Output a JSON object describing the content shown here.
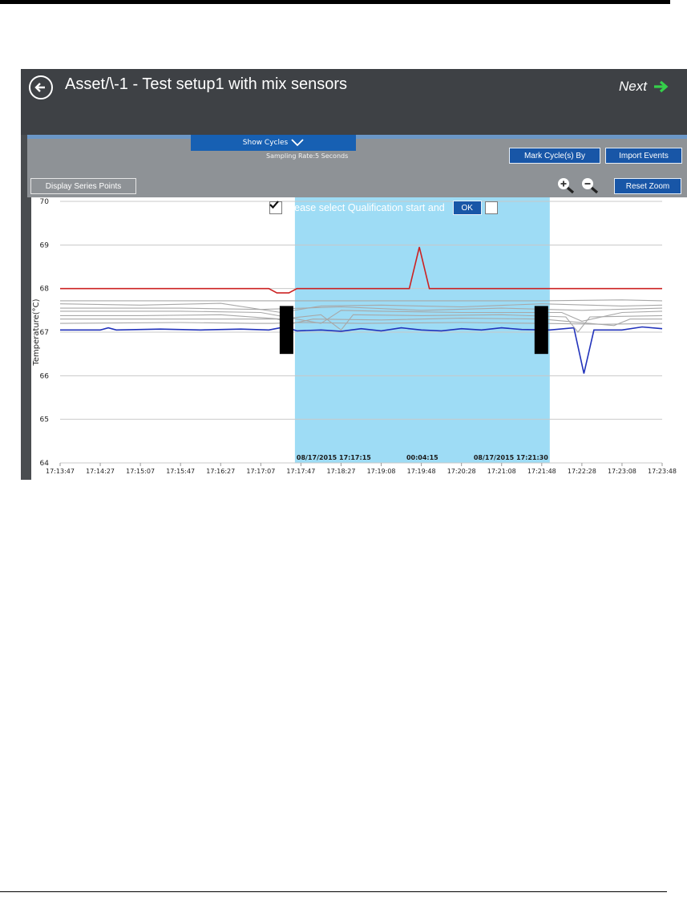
{
  "window": {
    "title": "Asset/\\-1 - Test setup1 with mix sensors",
    "next_label": "Next"
  },
  "toolbar": {
    "show_cycles_label": "Show Cycles",
    "sampling_rate": "Sampling Rate:5 Seconds",
    "mark_cycles_label": "Mark Cycle(s) By",
    "import_events_label": "Import Events",
    "display_series_points_label": "Display Series Points",
    "reset_zoom_label": "Reset Zoom"
  },
  "icons": {
    "back": "back-arrow-circle-icon",
    "next": "arrow-right-icon",
    "zoom_in": "zoom-in-icon",
    "zoom_out": "zoom-out-icon",
    "check": "checkmark-icon",
    "expand": "chevron-down-icon"
  },
  "selection": {
    "prompt": "Please select Qualification start and",
    "ok_label": "OK",
    "start": "08/17/2015 17:17:15",
    "duration": "00:04:15",
    "end": "08/17/2015 17:21:30",
    "color": "#9edcf5"
  },
  "chart_data": {
    "type": "line",
    "ylabel": "Temperature(°C)",
    "ylim": [
      64,
      70
    ],
    "y_ticks": [
      "64",
      "65",
      "66",
      "67",
      "68",
      "69",
      "70"
    ],
    "x_ticks": [
      "17:13:47",
      "17:14:27",
      "17:15:07",
      "17:15:47",
      "17:16:27",
      "17:17:07",
      "17:17:47",
      "17:18:27",
      "17:19:08",
      "17:19:48",
      "17:20:28",
      "17:21:08",
      "17:21:48",
      "17:22:28",
      "17:23:08",
      "17:23:48"
    ],
    "grid": true,
    "series": [
      {
        "color": "#cc2222",
        "points": [
          [
            0,
            68.0
          ],
          [
            4.5,
            68.0
          ],
          [
            5.2,
            68.0
          ],
          [
            5.4,
            67.9
          ],
          [
            5.7,
            67.9
          ],
          [
            5.9,
            68.0
          ],
          [
            8.7,
            68.0
          ],
          [
            8.95,
            68.95
          ],
          [
            9.2,
            68.0
          ],
          [
            15,
            68.0
          ]
        ]
      },
      {
        "color": "#2233bb",
        "points": [
          [
            0,
            67.05
          ],
          [
            1,
            67.05
          ],
          [
            1.2,
            67.1
          ],
          [
            1.4,
            67.05
          ],
          [
            2.5,
            67.07
          ],
          [
            3.5,
            67.05
          ],
          [
            4.5,
            67.07
          ],
          [
            5.2,
            67.05
          ],
          [
            5.6,
            67.12
          ],
          [
            5.9,
            67.03
          ],
          [
            6.5,
            67.05
          ],
          [
            7.0,
            67.02
          ],
          [
            7.5,
            67.08
          ],
          [
            8.0,
            67.03
          ],
          [
            8.5,
            67.1
          ],
          [
            9.0,
            67.05
          ],
          [
            9.5,
            67.03
          ],
          [
            10.0,
            67.08
          ],
          [
            10.5,
            67.05
          ],
          [
            11.0,
            67.1
          ],
          [
            11.5,
            67.06
          ],
          [
            12.2,
            67.05
          ],
          [
            12.8,
            67.1
          ],
          [
            13.05,
            66.05
          ],
          [
            13.3,
            67.05
          ],
          [
            14,
            67.05
          ],
          [
            14.5,
            67.12
          ],
          [
            15,
            67.08
          ]
        ]
      },
      {
        "color": "#a8a8a8",
        "points": [
          [
            0,
            67.72
          ],
          [
            2,
            67.72
          ],
          [
            4,
            67.72
          ],
          [
            6,
            67.72
          ],
          [
            8,
            67.72
          ],
          [
            10,
            67.72
          ],
          [
            12,
            67.72
          ],
          [
            14,
            67.74
          ],
          [
            15,
            67.72
          ]
        ]
      },
      {
        "color": "#a8a8a8",
        "points": [
          [
            0,
            67.65
          ],
          [
            2,
            67.62
          ],
          [
            4,
            67.66
          ],
          [
            5.5,
            67.45
          ],
          [
            6.5,
            67.6
          ],
          [
            8,
            67.62
          ],
          [
            10,
            67.58
          ],
          [
            12,
            67.65
          ],
          [
            14,
            67.6
          ],
          [
            15,
            67.62
          ]
        ]
      },
      {
        "color": "#a8a8a8",
        "points": [
          [
            0,
            67.55
          ],
          [
            3,
            67.55
          ],
          [
            5,
            67.52
          ],
          [
            7,
            67.58
          ],
          [
            9,
            67.5
          ],
          [
            11,
            67.55
          ],
          [
            13,
            67.5
          ],
          [
            15,
            67.55
          ]
        ]
      },
      {
        "color": "#a8a8a8",
        "points": [
          [
            0,
            67.48
          ],
          [
            3,
            67.48
          ],
          [
            5,
            67.45
          ],
          [
            6.5,
            67.2
          ],
          [
            7.0,
            67.5
          ],
          [
            8,
            67.48
          ],
          [
            10,
            67.45
          ],
          [
            12.5,
            67.45
          ],
          [
            13,
            67.25
          ],
          [
            14,
            67.45
          ],
          [
            15,
            67.48
          ]
        ]
      },
      {
        "color": "#a8a8a8",
        "points": [
          [
            0,
            67.38
          ],
          [
            2,
            67.38
          ],
          [
            4,
            67.4
          ],
          [
            5.5,
            67.3
          ],
          [
            6.5,
            67.4
          ],
          [
            7.0,
            67.05
          ],
          [
            7.3,
            67.4
          ],
          [
            9,
            67.38
          ],
          [
            11,
            67.4
          ],
          [
            12.6,
            67.35
          ],
          [
            12.9,
            67.0
          ],
          [
            13.2,
            67.35
          ],
          [
            15,
            67.38
          ]
        ]
      },
      {
        "color": "#a8a8a8",
        "points": [
          [
            0,
            67.3
          ],
          [
            4,
            67.3
          ],
          [
            5.4,
            67.3
          ],
          [
            5.8,
            67.2
          ],
          [
            6.3,
            67.3
          ],
          [
            8,
            67.28
          ],
          [
            10,
            67.32
          ],
          [
            12,
            67.3
          ],
          [
            13.8,
            67.15
          ],
          [
            14.2,
            67.3
          ],
          [
            15,
            67.3
          ]
        ]
      },
      {
        "color": "#a8a8a8",
        "points": [
          [
            0,
            67.2
          ],
          [
            3,
            67.22
          ],
          [
            4.8,
            67.2
          ],
          [
            5.3,
            67.2
          ],
          [
            6,
            67.22
          ],
          [
            7.5,
            67.2
          ],
          [
            10,
            67.22
          ],
          [
            12,
            67.2
          ],
          [
            13.5,
            67.18
          ],
          [
            15,
            67.2
          ]
        ]
      }
    ]
  }
}
